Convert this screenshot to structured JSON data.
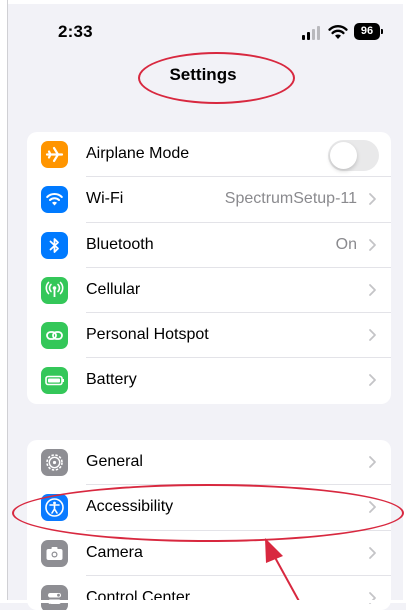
{
  "status_bar": {
    "time": "2:33",
    "battery": "96"
  },
  "header": {
    "title": "Settings"
  },
  "group1": [
    {
      "label": "Airplane Mode",
      "value": "",
      "icon": "airplane-icon",
      "color": "#ff9500",
      "control": "toggle",
      "toggle_on": false
    },
    {
      "label": "Wi-Fi",
      "value": "SpectrumSetup-11",
      "icon": "wifi-icon",
      "color": "#007aff",
      "control": "chevron"
    },
    {
      "label": "Bluetooth",
      "value": "On",
      "icon": "bluetooth-icon",
      "color": "#007aff",
      "control": "chevron"
    },
    {
      "label": "Cellular",
      "value": "",
      "icon": "cellular-icon",
      "color": "#34c759",
      "control": "chevron"
    },
    {
      "label": "Personal Hotspot",
      "value": "",
      "icon": "hotspot-icon",
      "color": "#34c759",
      "control": "chevron"
    },
    {
      "label": "Battery",
      "value": "",
      "icon": "battery-icon",
      "color": "#34c759",
      "control": "chevron"
    }
  ],
  "group2": [
    {
      "label": "General",
      "icon": "gear-icon",
      "color": "#8e8e93",
      "control": "chevron"
    },
    {
      "label": "Accessibility",
      "icon": "accessibility-icon",
      "color": "#0a7aff",
      "control": "chevron"
    },
    {
      "label": "Camera",
      "icon": "camera-icon",
      "color": "#8e8e93",
      "control": "chevron"
    },
    {
      "label": "Control Center",
      "icon": "control-center-icon",
      "color": "#8e8e93",
      "control": "chevron"
    }
  ],
  "annotation_color": "#d8283f"
}
